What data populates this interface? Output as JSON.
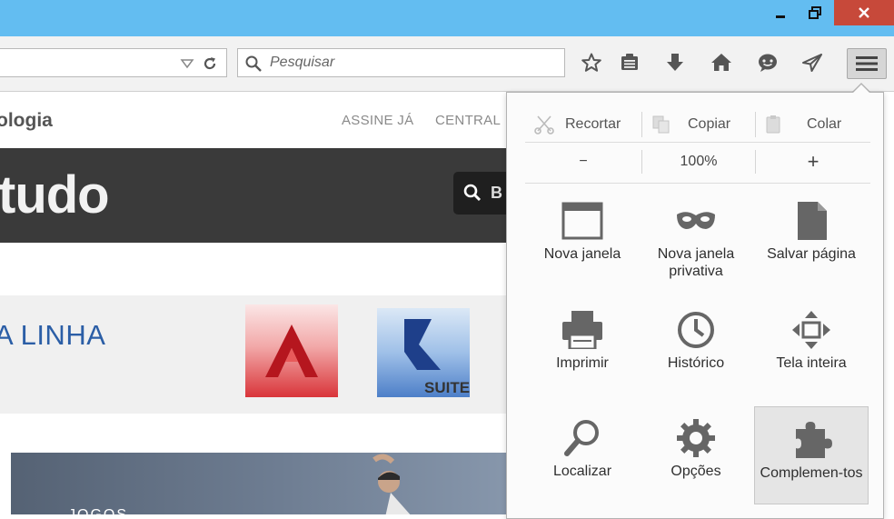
{
  "toolbar": {
    "search_placeholder": "Pesquisar"
  },
  "page": {
    "brand": "ologia",
    "links": [
      "ASSINE JÁ",
      "CENTRAL"
    ],
    "banner_text": "tudo",
    "banner_search_hint": "B",
    "promo_text": "A LINHA",
    "suite_label": "SUITE",
    "photo_caption": "JOGOS"
  },
  "menu": {
    "edit": {
      "cut": "Recortar",
      "copy": "Copiar",
      "paste": "Colar"
    },
    "zoom": {
      "out": "−",
      "level": "100%",
      "in": "+"
    },
    "items": [
      {
        "label": "Nova janela",
        "icon": "window-icon"
      },
      {
        "label": "Nova janela privativa",
        "icon": "mask-icon"
      },
      {
        "label": "Salvar página",
        "icon": "page-icon"
      },
      {
        "label": "Imprimir",
        "icon": "printer-icon"
      },
      {
        "label": "Histórico",
        "icon": "clock-icon"
      },
      {
        "label": "Tela inteira",
        "icon": "fullscreen-icon"
      },
      {
        "label": "Localizar",
        "icon": "magnifier-icon"
      },
      {
        "label": "Opções",
        "icon": "gear-icon"
      },
      {
        "label": "Complemen-tos",
        "icon": "puzzle-icon"
      }
    ]
  },
  "colors": {
    "titlebar": "#63bdf1",
    "close": "#c7493a",
    "icon_gray": "#666666",
    "promo_blue": "#2b5ea6"
  }
}
